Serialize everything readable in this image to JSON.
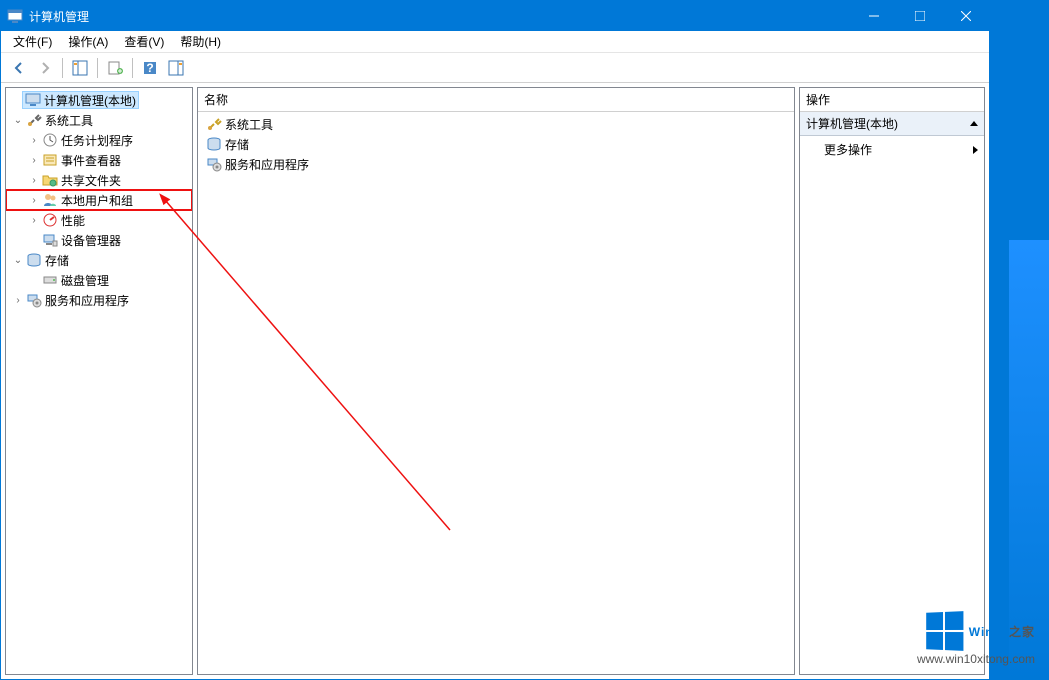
{
  "window": {
    "title": "计算机管理"
  },
  "titlebar_buttons": {
    "min": "minimize",
    "max": "maximize",
    "close": "close"
  },
  "menus": [
    "文件(F)",
    "操作(A)",
    "查看(V)",
    "帮助(H)"
  ],
  "tree": {
    "root": "计算机管理(本地)",
    "systools": "系统工具",
    "systools_children": [
      "任务计划程序",
      "事件查看器",
      "共享文件夹",
      "本地用户和组",
      "性能",
      "设备管理器"
    ],
    "storage": "存储",
    "storage_children": [
      "磁盘管理"
    ],
    "services": "服务和应用程序"
  },
  "list": {
    "header": "名称",
    "items": [
      "系统工具",
      "存储",
      "服务和应用程序"
    ]
  },
  "actions": {
    "header": "操作",
    "group": "计算机管理(本地)",
    "item1": "更多操作"
  },
  "watermark": {
    "brand": "Win10",
    "suffix": "之家",
    "url": "www.win10xitong.com"
  }
}
